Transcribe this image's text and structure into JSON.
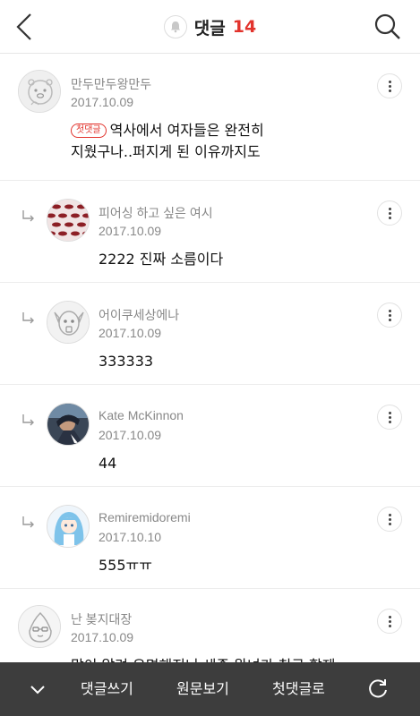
{
  "header": {
    "title": "댓글",
    "count": "14",
    "back_icon": "back-arrow-icon",
    "search_icon": "search-icon",
    "bell_icon": "bell-icon"
  },
  "comments": [
    {
      "author": "만두만두왕만두",
      "date": "2017.10.09",
      "badge": "첫댓글",
      "text_line1": "역사에서 여자들은 완전히",
      "text_line2": "지웠구나..퍼지게 된 이유까지도"
    },
    {
      "author": "피어싱 하고 싶은 여시",
      "date": "2017.10.09",
      "text": "2222 진짜 소름이다"
    },
    {
      "author": "어이쿠세상에나",
      "date": "2017.10.09",
      "text": "333333"
    },
    {
      "author": "Kate McKinnon",
      "date": "2017.10.09",
      "text": "44"
    },
    {
      "author": "Remiremidoremi",
      "date": "2017.10.10",
      "text": "555ㅠㅠ"
    },
    {
      "author": "난 봊지대장",
      "date": "2017.10.09",
      "text": "많이 알려 유명해지니 세종 왕녀가 친구 할제"
    }
  ],
  "toolbar": {
    "collapse_icon": "chevron-down-icon",
    "write_label": "댓글쓰기",
    "original_label": "원문보기",
    "first_comment_label": "첫댓글로",
    "refresh_icon": "refresh-icon"
  },
  "colors": {
    "accent": "#e2332c",
    "toolbar_bg": "#3d3d3d"
  }
}
